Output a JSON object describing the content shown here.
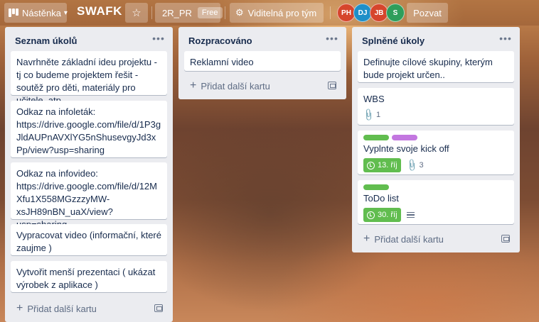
{
  "topbar": {
    "board_switcher": "Nástěnka",
    "board_title": "SWAFK",
    "team": "2R_PR",
    "plan_badge": "Free",
    "visibility": "Viditelná pro tým",
    "members": [
      {
        "initials": "PH",
        "color": "#d6452c"
      },
      {
        "initials": "DJ",
        "color": "#1e8fc8"
      },
      {
        "initials": "JB",
        "color": "#d6452c"
      },
      {
        "initials": "S",
        "color": "#2e9e5b"
      }
    ],
    "invite": "Pozvat"
  },
  "add_card_label": "Přidat další kartu",
  "lists": [
    {
      "title": "Seznam úkolů",
      "cards": [
        {
          "text": "Navrhněte základní ideu projektu -tj co budeme projektem řešit - soutěž pro děti, materiály pro učitele, atp."
        },
        {
          "text": "Odkaz na infoleták: https://drive.google.com/file/d/1P3gJldAUPnAVXlYG5nShusevgyJd3xPp/view?usp=sharing"
        },
        {
          "text": "Odkaz na infovideo: https://drive.google.com/file/d/12MXfu1X558MGzzzyMW-xsJH89nBN_uaX/view?usp=sharing"
        },
        {
          "text": "Vypracovat video (informační, které zaujme )"
        },
        {
          "text": "Vytvořit menší prezentaci ( ukázat výrobek z aplikace )"
        }
      ]
    },
    {
      "title": "Rozpracováno",
      "cards": [
        {
          "text": "Reklamní video"
        }
      ]
    },
    {
      "title": "Splněné úkoly",
      "cards": [
        {
          "text": "Definujte cílové skupiny, kterým bude projekt určen.."
        },
        {
          "text": "WBS",
          "attachments": "1"
        },
        {
          "text": "Vyplnte svoje kick off",
          "labels": [
            "#61bd4f",
            "#c377e0"
          ],
          "due": "13. říj",
          "attachments": "3"
        },
        {
          "text": "ToDo list",
          "labels": [
            "#61bd4f"
          ],
          "due": "30. říj",
          "description": true
        }
      ]
    }
  ],
  "colors": {
    "list_bg": "#ebecf0",
    "label_green": "#61bd4f",
    "label_purple": "#c377e0",
    "due_complete": "#61bd4f"
  },
  "icons": [
    "board-icon",
    "chevron-down-icon",
    "star-icon",
    "visibility-icon",
    "more-icon",
    "plus-icon",
    "template-icon",
    "clock-icon",
    "attachment-icon",
    "description-icon"
  ]
}
